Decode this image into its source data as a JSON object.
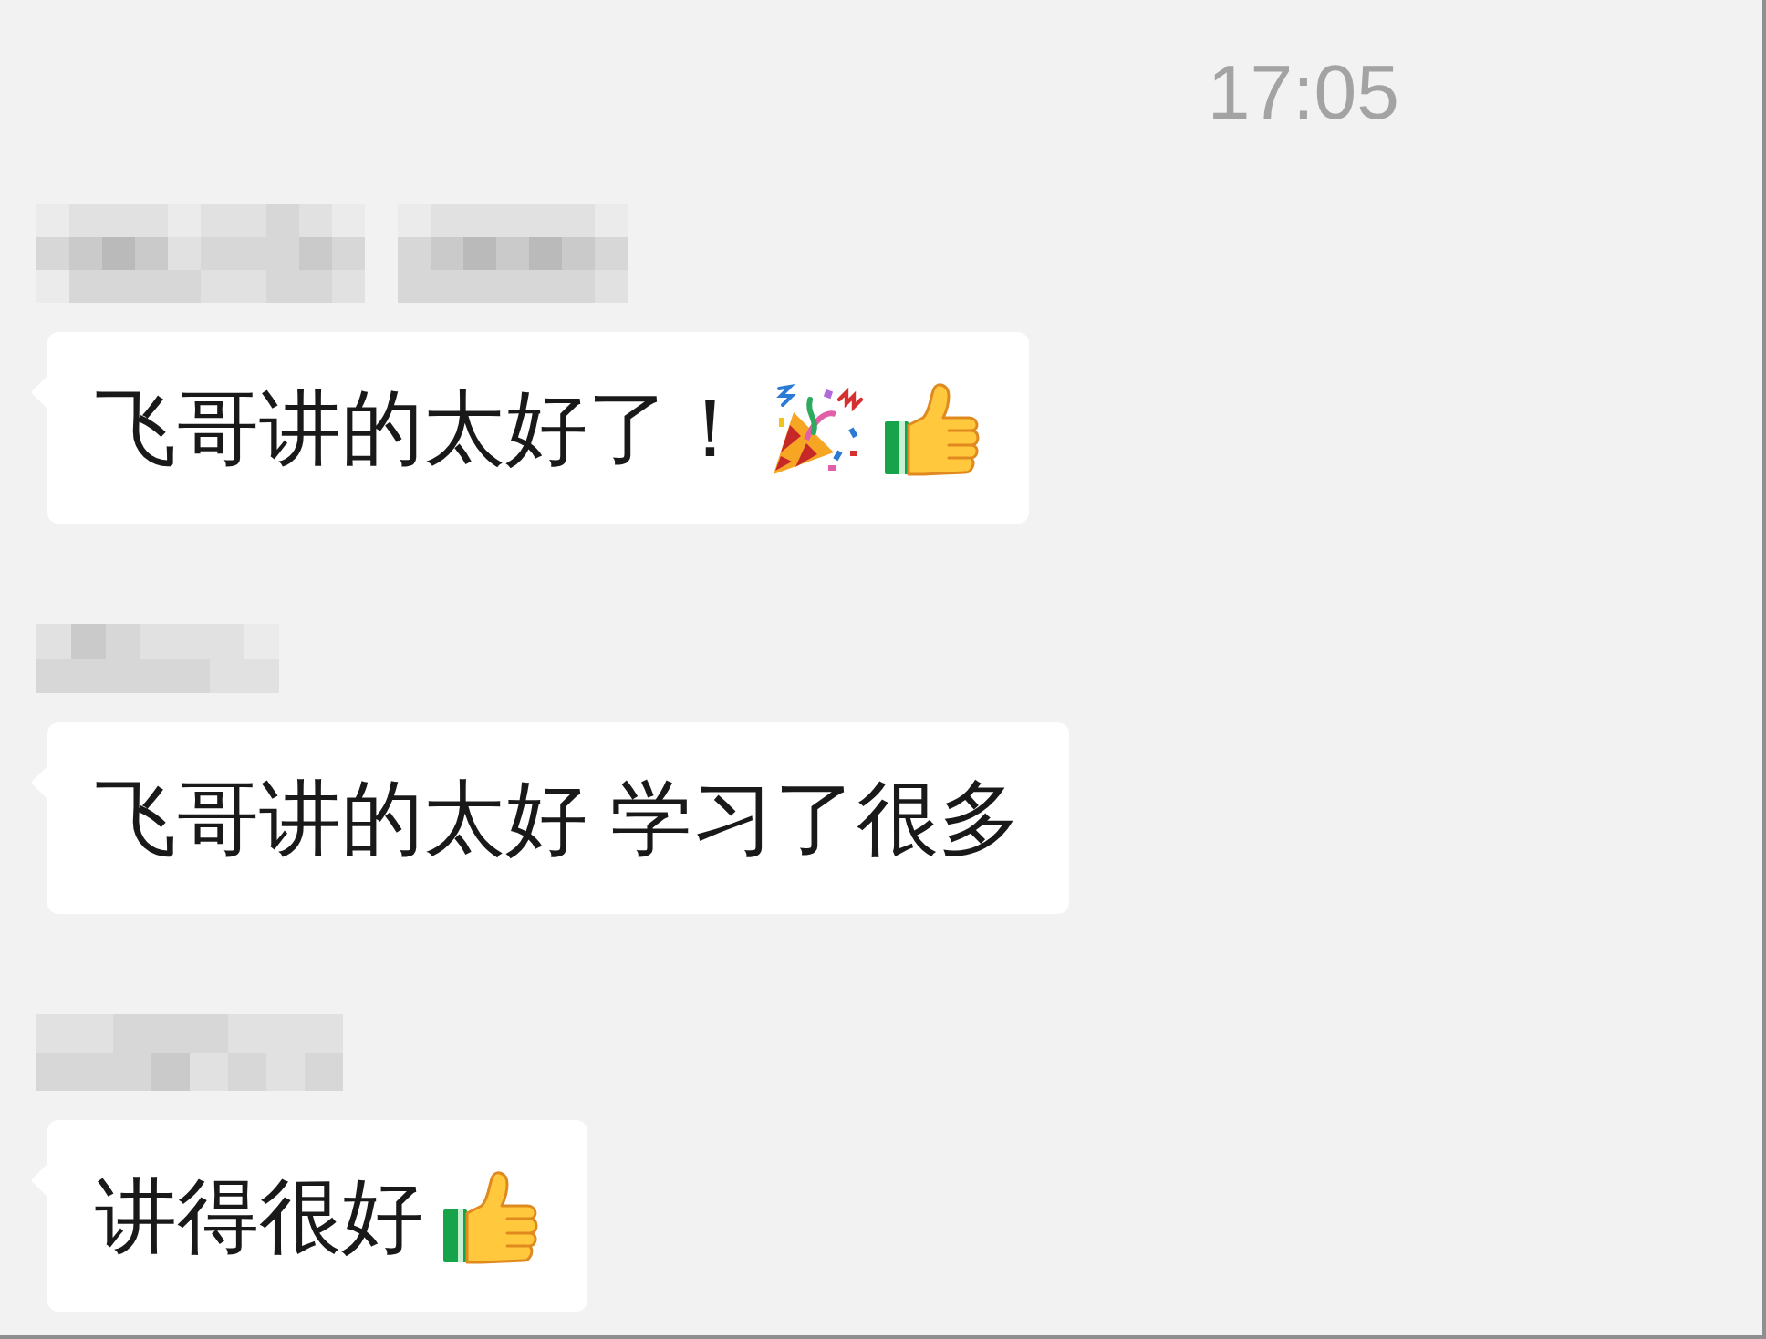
{
  "time": "17:05",
  "messages": [
    {
      "sender_blurred": true,
      "parts": [
        {
          "kind": "text",
          "text": "飞哥讲的太好了！"
        },
        {
          "kind": "party"
        },
        {
          "kind": "thumbsup"
        }
      ]
    },
    {
      "sender_blurred": true,
      "parts": [
        {
          "kind": "text",
          "text": "飞哥讲的太好 学习了很多"
        }
      ]
    },
    {
      "sender_blurred": true,
      "parts": [
        {
          "kind": "text",
          "text": "讲得很好"
        },
        {
          "kind": "thumbsup"
        }
      ]
    }
  ]
}
